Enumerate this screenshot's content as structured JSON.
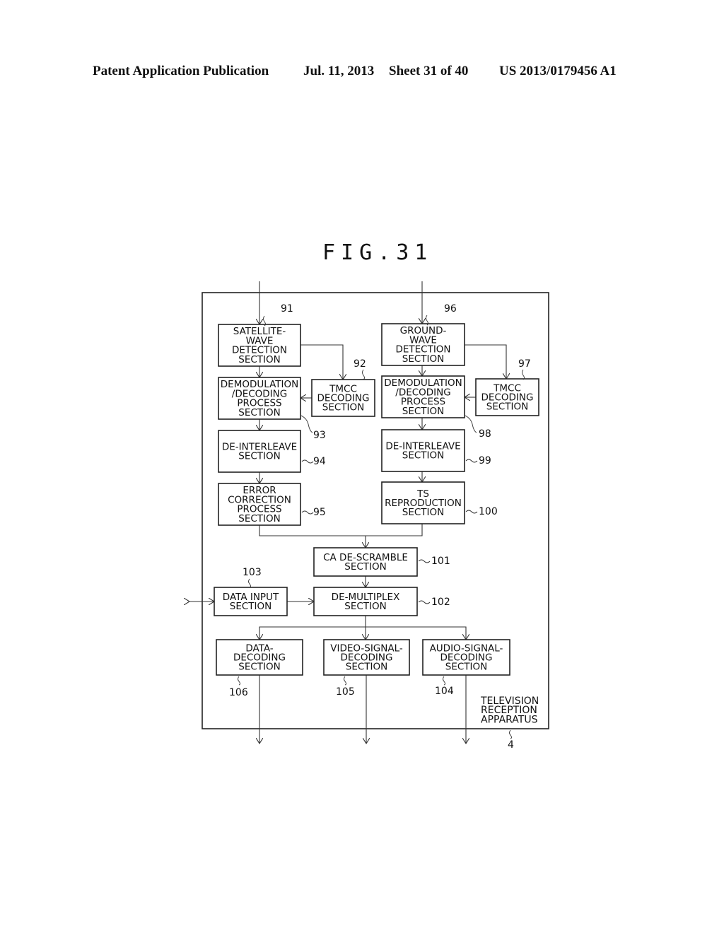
{
  "header": {
    "publication": "Patent Application Publication",
    "date": "Jul. 11, 2013",
    "sheet": "Sheet 31 of 40",
    "number": "US 2013/0179456 A1"
  },
  "figure": {
    "title": "FIG.31",
    "apparatus_label": [
      "TELEVISION",
      "RECEPTION",
      "APPARATUS"
    ],
    "apparatus_ref": "4",
    "blocks": [
      {
        "id": "b91",
        "ref": "91",
        "lines": [
          "SATELLITE-",
          "WAVE",
          "DETECTION",
          "SECTION"
        ]
      },
      {
        "id": "b92",
        "ref": "92",
        "lines": [
          "TMCC",
          "DECODING",
          "SECTION"
        ]
      },
      {
        "id": "b93",
        "ref": "93",
        "lines": [
          "DEMODULATION",
          "/DECODING",
          "PROCESS",
          "SECTION"
        ]
      },
      {
        "id": "b94",
        "ref": "94",
        "lines": [
          "DE-INTERLEAVE",
          "SECTION"
        ]
      },
      {
        "id": "b95",
        "ref": "95",
        "lines": [
          "ERROR",
          "CORRECTION",
          "PROCESS",
          "SECTION"
        ]
      },
      {
        "id": "b96",
        "ref": "96",
        "lines": [
          "GROUND-",
          "WAVE",
          "DETECTION",
          "SECTION"
        ]
      },
      {
        "id": "b97",
        "ref": "97",
        "lines": [
          "TMCC",
          "DECODING",
          "SECTION"
        ]
      },
      {
        "id": "b98",
        "ref": "98",
        "lines": [
          "DEMODULATION",
          "/DECODING",
          "PROCESS",
          "SECTION"
        ]
      },
      {
        "id": "b99",
        "ref": "99",
        "lines": [
          "DE-INTERLEAVE",
          "SECTION"
        ]
      },
      {
        "id": "b100",
        "ref": "100",
        "lines": [
          "TS",
          "REPRODUCTION",
          "SECTION"
        ]
      },
      {
        "id": "b101",
        "ref": "101",
        "lines": [
          "CA DE-SCRAMBLE",
          "SECTION"
        ]
      },
      {
        "id": "b102",
        "ref": "102",
        "lines": [
          "DE-MULTIPLEX",
          "SECTION"
        ]
      },
      {
        "id": "b103",
        "ref": "103",
        "lines": [
          "DATA INPUT",
          "SECTION"
        ]
      },
      {
        "id": "b104",
        "ref": "104",
        "lines": [
          "AUDIO-SIGNAL-",
          "DECODING",
          "SECTION"
        ]
      },
      {
        "id": "b105",
        "ref": "105",
        "lines": [
          "VIDEO-SIGNAL-",
          "DECODING",
          "SECTION"
        ]
      },
      {
        "id": "b106",
        "ref": "106",
        "lines": [
          "DATA-",
          "DECODING",
          "SECTION"
        ]
      }
    ]
  }
}
